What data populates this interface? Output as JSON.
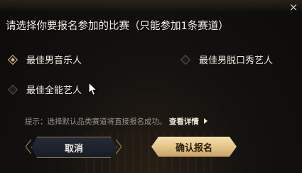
{
  "dialog": {
    "title": "请选择你要报名参加的比赛（只能参加1条赛道）",
    "close_icon": "×"
  },
  "options": [
    {
      "label": "最佳男音乐人",
      "selected": true
    },
    {
      "label": "最佳男脱口秀艺人",
      "selected": false
    },
    {
      "label": "最佳全能艺人",
      "selected": false
    }
  ],
  "hint": {
    "text": "提示：选择默认品类赛道将直接报名成功。",
    "link": "查看详情"
  },
  "buttons": {
    "cancel": "取消",
    "confirm": "确认报名"
  },
  "colors": {
    "accent_gold": "#e2be82",
    "background": "#0c0b0a"
  }
}
